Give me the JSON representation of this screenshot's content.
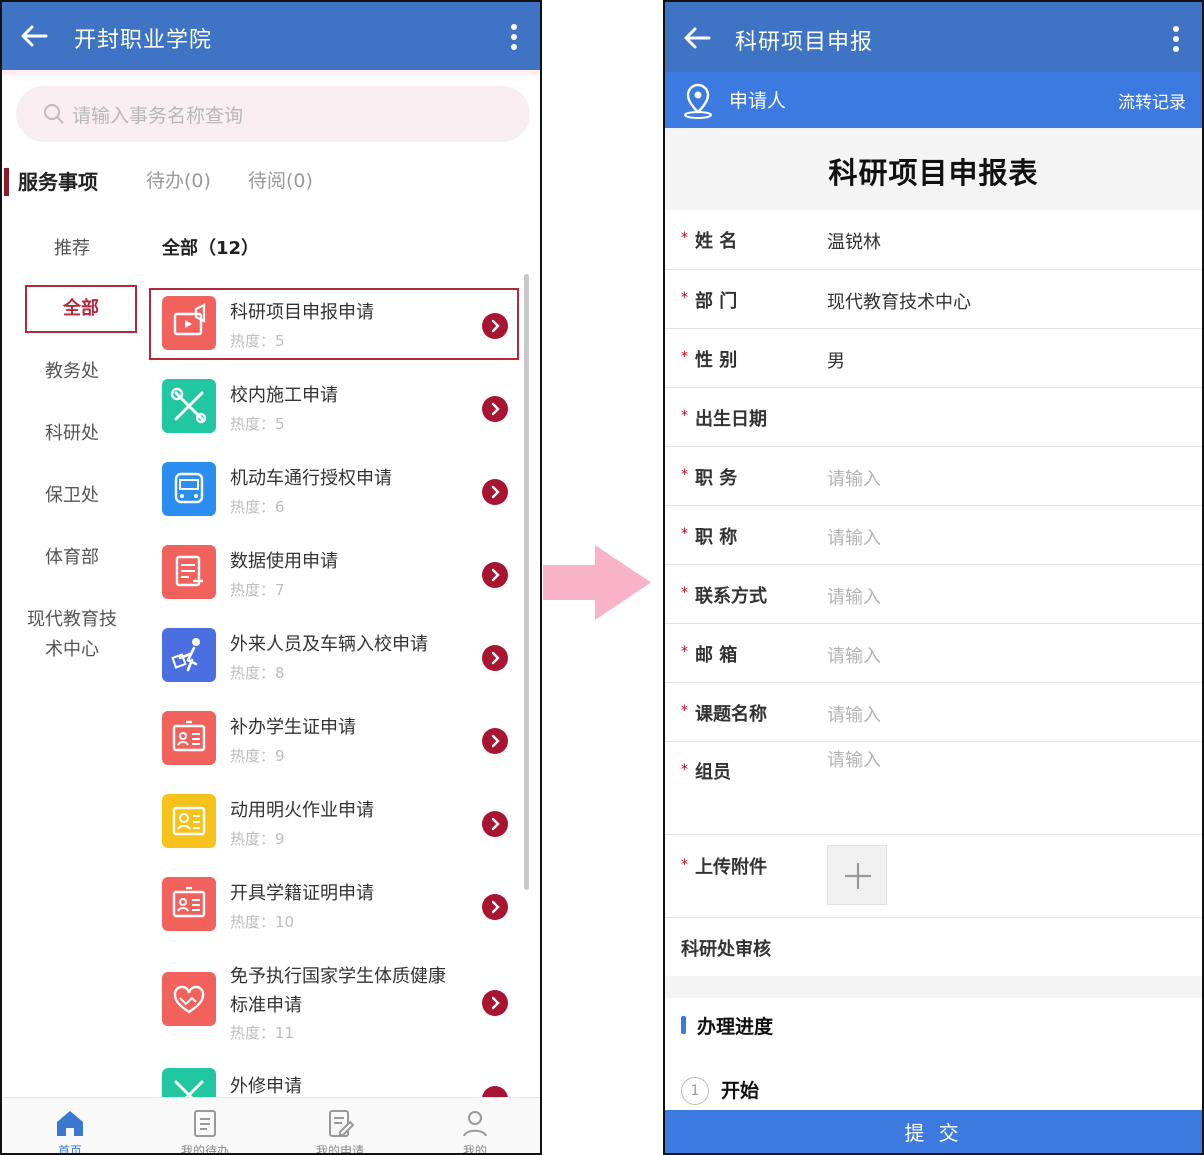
{
  "left": {
    "header": {
      "title": "开封职业学院"
    },
    "search": {
      "placeholder": "请输入事务名称查询"
    },
    "tabs": [
      "服务事项",
      "待办(0)",
      "待阅(0)"
    ],
    "categories": [
      "推荐",
      "全部",
      "教务处",
      "科研处",
      "保卫处",
      "体育部",
      "现代教育技",
      "术中心"
    ],
    "list_title": "全部（12）",
    "items": [
      {
        "name": "科研项目申报申请",
        "heat": "热度：5",
        "color": "#f2625d",
        "icon": "megaphone-icon"
      },
      {
        "name": "校内施工申请",
        "heat": "热度：5",
        "color": "#21c7a0",
        "icon": "tools-icon"
      },
      {
        "name": "机动车通行授权申请",
        "heat": "热度：6",
        "color": "#2b8df0",
        "icon": "bus-icon"
      },
      {
        "name": "数据使用申请",
        "heat": "热度：7",
        "color": "#f2625d",
        "icon": "document-icon"
      },
      {
        "name": "外来人员及车辆入校申请",
        "heat": "热度：8",
        "color": "#4a6fe0",
        "icon": "visitor-icon"
      },
      {
        "name": "补办学生证申请",
        "heat": "热度：9",
        "color": "#f2625d",
        "icon": "id-card-icon"
      },
      {
        "name": "动用明火作业申请",
        "heat": "热度：9",
        "color": "#f7c21b",
        "icon": "certificate-icon"
      },
      {
        "name": "开具学籍证明申请",
        "heat": "热度：10",
        "color": "#f2625d",
        "icon": "id-card-icon"
      },
      {
        "name": "免予执行国家学生体质健康",
        "name2": "标准申请",
        "heat": "热度：11",
        "color": "#f2625d",
        "icon": "handshake-icon"
      },
      {
        "name": "外修申请",
        "heat": "",
        "color": "#21c7a0",
        "icon": "tools-icon"
      }
    ],
    "tabbar": [
      "首页",
      "我的待办",
      "我的申请",
      "我的"
    ]
  },
  "right": {
    "header": {
      "title": "科研项目申报"
    },
    "sub": {
      "label": "申请人",
      "record": "流转记录"
    },
    "form_title": "科研项目申报表",
    "fields": [
      {
        "star": "*",
        "key": "姓 名",
        "value": "温锐林",
        "placeholder": false
      },
      {
        "star": "*",
        "key": "部 门",
        "value": "现代教育技术中心",
        "placeholder": false
      },
      {
        "star": "*",
        "key": "性 别",
        "value": "男",
        "placeholder": false
      },
      {
        "star": "*",
        "key": "出生日期",
        "value": "",
        "placeholder": false
      },
      {
        "star": "*",
        "key": "职 务",
        "value": "请输入",
        "placeholder": true
      },
      {
        "star": "*",
        "key": "职 称",
        "value": "请输入",
        "placeholder": true
      },
      {
        "star": "*",
        "key": "联系方式",
        "value": "请输入",
        "placeholder": true
      },
      {
        "star": "*",
        "key": "邮 箱",
        "value": "请输入",
        "placeholder": true
      },
      {
        "star": "*",
        "key": "课题名称",
        "value": "请输入",
        "placeholder": true
      },
      {
        "star": "*",
        "key": "组员",
        "value": "请输入",
        "placeholder": true
      }
    ],
    "upload": {
      "star": "*",
      "key": "上传附件"
    },
    "review": "科研处审核",
    "progress_title": "办理进度",
    "step": {
      "num": "1",
      "label": "开始"
    },
    "submit": "提 交"
  }
}
